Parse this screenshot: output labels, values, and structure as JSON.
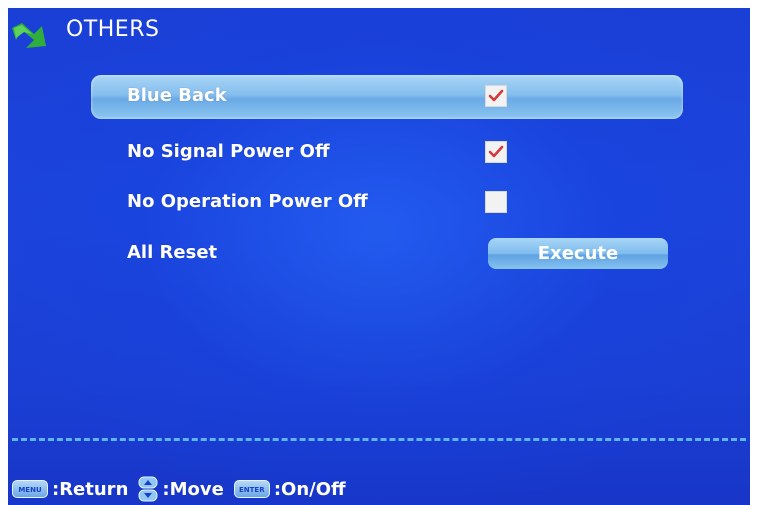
{
  "header": {
    "title": "OTHERS",
    "icon": "green-arrow-icon"
  },
  "settings": [
    {
      "label": "Blue Back",
      "control": "checkbox",
      "checked": true,
      "selected": true
    },
    {
      "label": "No Signal Power Off",
      "control": "checkbox",
      "checked": true,
      "selected": false
    },
    {
      "label": "No Operation Power Off",
      "control": "checkbox",
      "checked": false,
      "selected": false
    },
    {
      "label": "All Reset",
      "control": "button",
      "button_label": "Execute",
      "selected": false
    }
  ],
  "footer": {
    "menu_key": "MENU",
    "menu_action": ":Return",
    "move_action": ":Move",
    "enter_key": "ENTER",
    "enter_action": ":On/Off"
  },
  "colors": {
    "background": "#1c44dc",
    "highlight": "#84bdee",
    "checkmark": "#d23a3a",
    "divider": "#5fb4f2"
  }
}
